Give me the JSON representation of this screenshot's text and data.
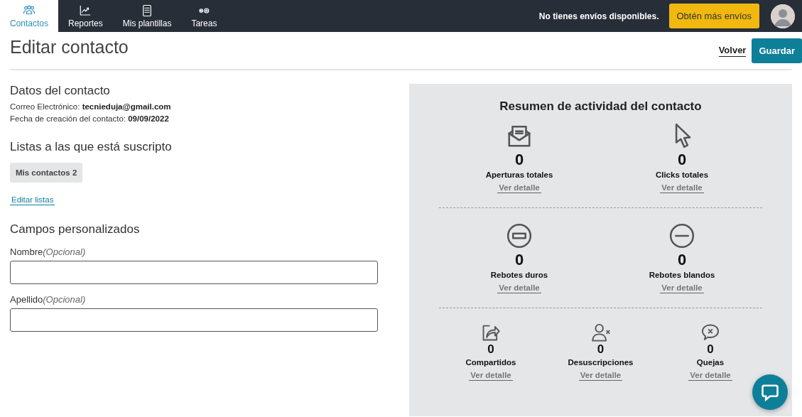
{
  "nav": {
    "items": [
      {
        "label": "Contactos",
        "kind": "contacts",
        "selected": true
      },
      {
        "label": "Reportes",
        "kind": "reports",
        "selected": false
      },
      {
        "label": "Mis plantillas",
        "kind": "templates",
        "selected": false
      },
      {
        "label": "Tareas",
        "kind": "tasks",
        "selected": false
      }
    ],
    "notice": "No tienes envíos disponibles.",
    "cta": "Obtén más envíos"
  },
  "header": {
    "title": "Editar contacto",
    "back": "Volver",
    "save": "Guardar"
  },
  "details": {
    "heading": "Datos del contacto",
    "lines": [
      {
        "label": "Correo Electrónico:",
        "value": "tecnieduja@gmail.com"
      },
      {
        "label": "Fecha de creación del contacto:",
        "value": "09/09/2022"
      }
    ]
  },
  "lists": {
    "heading": "Listas a las que está suscripto",
    "tags": [
      "Mis contactos 2"
    ],
    "edit": "Editar listas"
  },
  "custom_fields": {
    "heading": "Campos personalizados",
    "fields": [
      {
        "label": "Nombre",
        "hint": "(Opcional)"
      },
      {
        "label": "Apellido",
        "hint": "(Opcional)"
      }
    ]
  },
  "activity": {
    "title": "Resumen de actividad del contacto",
    "rows": [
      [
        {
          "kind": "opens",
          "value": "0",
          "label": "Aperturas totales",
          "link": "Ver detalle"
        },
        {
          "kind": "clicks",
          "value": "0",
          "label": "Clicks totales",
          "link": "Ver detalle"
        }
      ],
      [
        {
          "kind": "hard",
          "value": "0",
          "label": "Rebotes duros",
          "link": "Ver detalle"
        },
        {
          "kind": "soft",
          "value": "0",
          "label": "Rebotes blandos",
          "link": "Ver detalle"
        }
      ],
      [
        {
          "kind": "shares",
          "value": "0",
          "label": "Compartidos",
          "link": "Ver detalle"
        },
        {
          "kind": "unsubs",
          "value": "0",
          "label": "Desuscripciones",
          "link": "Ver detalle"
        },
        {
          "kind": "complaints",
          "value": "0",
          "label": "Quejas",
          "link": "Ver detalle"
        }
      ]
    ]
  }
}
